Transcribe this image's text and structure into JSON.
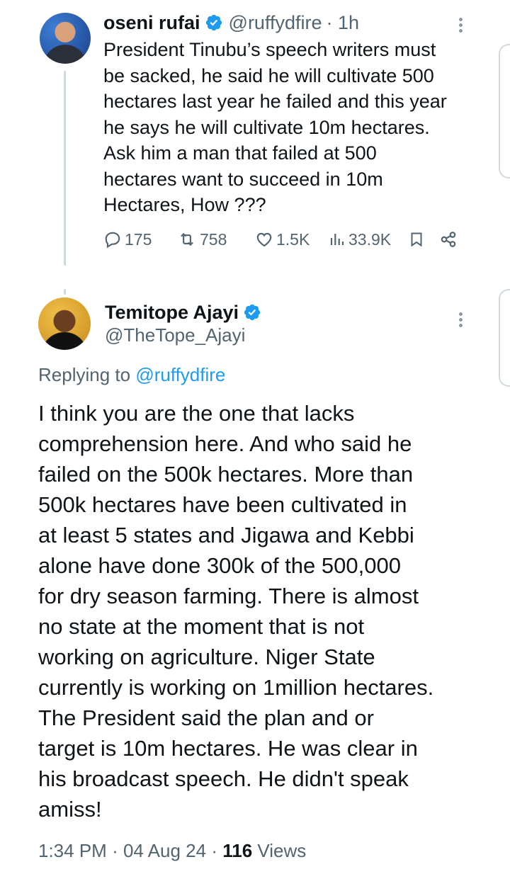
{
  "tweet1": {
    "author_name": "oseni rufai",
    "handle": "@ruffydfire",
    "time": "· 1h",
    "text": "President Tinubu’s speech writers must\nbe sacked, he said he will cultivate 500\nhectares last year he failed and this year\nhe says he will cultivate 10m hectares.\nAsk him a man that failed at 500\nhectares want to succeed in 10m\nHectares, How ???",
    "stats": {
      "replies": "175",
      "retweets": "758",
      "likes": "1.5K",
      "views": "33.9K"
    }
  },
  "tweet2": {
    "author_name": "Temitope Ajayi",
    "handle": "@TheTope_Ajayi",
    "replying_prefix": "Replying to ",
    "replying_to": "@ruffydfire",
    "text": "I think you are the one that lacks\ncomprehension here. And who said he\nfailed on the 500k hectares. More than\n500k hectares have been cultivated in\nat least 5 states and Jigawa and Kebbi\nalone have done 300k of the 500,000\nfor dry season farming. There is almost\nno state at the moment that is not\nworking on agriculture. Niger State\ncurrently is working on 1million hectares.\nThe President said the plan and or\ntarget is 10m hectares. He was clear in\nhis broadcast speech. He didn't speak\namiss!",
    "time": "1:34 PM",
    "date": "04 Aug 24",
    "views_count": "116",
    "views_label": "Views"
  },
  "colors": {
    "verified": "#1d9bf0",
    "secondary_text": "#536471",
    "link": "#1d9bf0"
  },
  "icons": [
    "verified-badge-icon",
    "more-options-icon",
    "reply-icon",
    "retweet-icon",
    "like-icon",
    "views-icon",
    "bookmark-icon",
    "share-icon"
  ]
}
